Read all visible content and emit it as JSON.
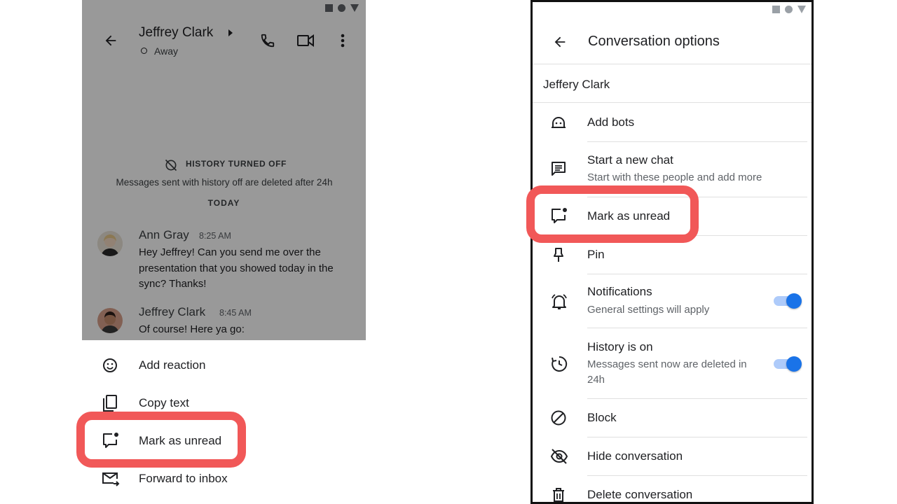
{
  "left": {
    "chat": {
      "contact_name": "Jeffrey Clark",
      "contact_status": "Away",
      "history_banner": "HISTORY TURNED OFF",
      "history_note": "Messages sent with history off are deleted after 24h",
      "day_label": "TODAY",
      "messages": [
        {
          "sender": "Ann Gray",
          "time": "8:25 AM",
          "text": "Hey Jeffrey! Can you send me over the presentation that you showed today in the sync? Thanks!"
        },
        {
          "sender": "Jeffrey Clark",
          "time": "8:45 AM",
          "text": "Of course! Here ya go:"
        }
      ]
    },
    "sheet": {
      "items": [
        {
          "label": "Add reaction",
          "icon": "smile-icon"
        },
        {
          "label": "Copy text",
          "icon": "copy-icon"
        },
        {
          "label": "Mark as unread",
          "icon": "mark-unread-icon"
        },
        {
          "label": "Forward to inbox",
          "icon": "forward-mail-icon"
        }
      ]
    }
  },
  "right": {
    "title": "Conversation options",
    "person": "Jeffery Clark",
    "options": [
      {
        "label": "Add bots",
        "icon": "bot-icon"
      },
      {
        "label": "Start a new chat",
        "sub": "Start with these people and add more",
        "icon": "chat-icon"
      },
      {
        "label": "Mark as unread",
        "icon": "mark-unread-icon"
      },
      {
        "label": "Pin",
        "icon": "pin-icon"
      },
      {
        "label": "Notifications",
        "sub": "General settings will apply",
        "icon": "bell-icon",
        "toggle": true
      },
      {
        "label": "History is on",
        "sub": "Messages sent now are deleted in 24h",
        "icon": "history-icon",
        "toggle": true
      },
      {
        "label": "Block",
        "icon": "block-icon"
      },
      {
        "label": "Hide conversation",
        "icon": "eye-off-icon"
      },
      {
        "label": "Delete conversation",
        "icon": "trash-icon"
      }
    ]
  },
  "colors": {
    "highlight": "#f15858",
    "toggle_on": "#1a73e8",
    "toggle_track": "#aecbfa"
  }
}
